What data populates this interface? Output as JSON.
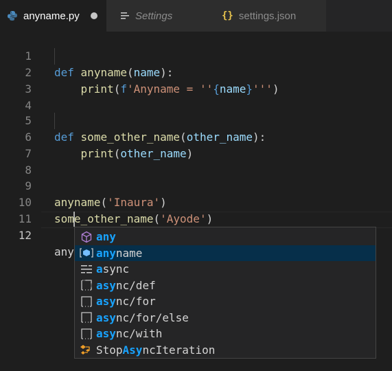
{
  "tabs": [
    {
      "label": "anyname.py",
      "icon": "python-icon"
    },
    {
      "label": "Settings",
      "icon": "settings-list-icon"
    },
    {
      "label": "settings.json",
      "icon": "json-braces-icon",
      "glyph": "{}"
    }
  ],
  "code": {
    "line_numbers": [
      "1",
      "2",
      "3",
      "4",
      "5",
      "6",
      "7",
      "8",
      "9",
      "10",
      "11",
      "12"
    ],
    "l1": {
      "def": "def",
      "sp": " ",
      "name": "anyname",
      "open": "(",
      "param": "name",
      "close": "):"
    },
    "l2": {
      "indent": "    ",
      "fn": "print",
      "open": "(",
      "prefix": "f",
      "str1": "'Anyname = ''",
      "brace_open": "{",
      "var": "name",
      "brace_close": "}",
      "str2": "'''",
      "close": ")"
    },
    "l5": {
      "def": "def",
      "sp": " ",
      "name": "some_other_name",
      "open": "(",
      "param": "other_name",
      "close": "):"
    },
    "l6": {
      "indent": "    ",
      "fn": "print",
      "open": "(",
      "arg": "other_name",
      "close": ")"
    },
    "l9": {
      "name": "anyname",
      "open": "(",
      "str": "'Inaura'",
      "close": ")"
    },
    "l10": {
      "name": "some_other_name",
      "open": "(",
      "str": "'Ayode'",
      "close": ")"
    },
    "l12": {
      "text": "any"
    }
  },
  "suggestions": [
    {
      "icon": "keyword-cube-icon",
      "match": "any",
      "rest": ""
    },
    {
      "icon": "variable-icon",
      "match": "any",
      "rest": "name"
    },
    {
      "icon": "keyword-list-icon",
      "match": "a",
      "mid": "sync",
      "rest": ""
    },
    {
      "icon": "snippet-icon",
      "match": "asy",
      "mid": "nc",
      "rest": "/def"
    },
    {
      "icon": "snippet-icon",
      "match": "asy",
      "mid": "nc",
      "rest": "/for"
    },
    {
      "icon": "snippet-icon",
      "match": "asy",
      "mid": "nc",
      "rest": "/for/else"
    },
    {
      "icon": "snippet-icon",
      "match": "asy",
      "mid": "nc",
      "rest": "/with"
    },
    {
      "icon": "class-icon",
      "pre": "Stop",
      "match": "Asy",
      "mid": "nc",
      "rest": "Iteration"
    }
  ],
  "colors": {
    "keyword": "#569cd6",
    "function": "#dcdcaa",
    "param": "#9cdcfe",
    "string": "#ce9178",
    "highlight": "#18a3ff",
    "selected": "#062f4a"
  }
}
